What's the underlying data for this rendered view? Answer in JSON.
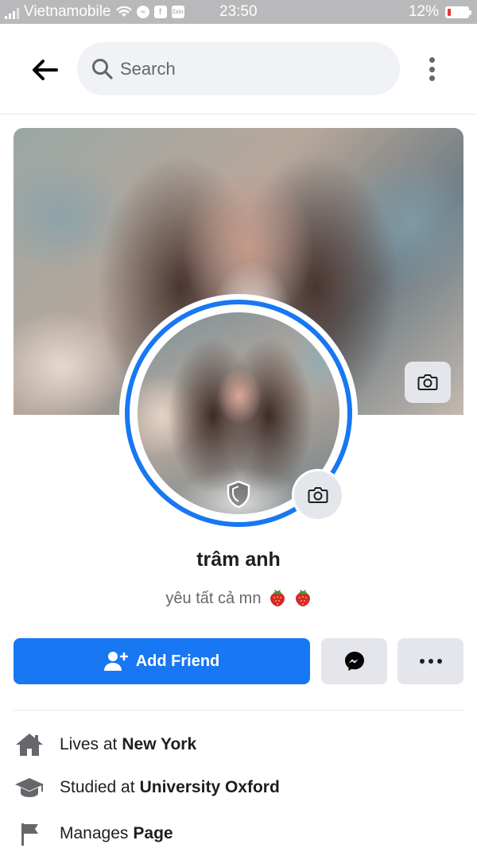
{
  "status_bar": {
    "carrier": "Vietnamobile",
    "time": "23:50",
    "battery": "12%",
    "battery_level": 0.12,
    "notification_icons": [
      "wifi-icon",
      "messenger-icon",
      "facebook-icon",
      "zalo-icon"
    ],
    "zalo_label": "Zalo"
  },
  "header": {
    "search_placeholder": "Search",
    "back_icon": "arrow-left-icon",
    "more_icon": "vertical-ellipsis-icon"
  },
  "profile": {
    "name": "trâm anh",
    "bio": "yêu tất cả mn",
    "bio_emojis": [
      "strawberry",
      "strawberry"
    ],
    "profile_guard": true
  },
  "actions": {
    "add_friend_label": "Add Friend",
    "message_icon": "messenger-icon",
    "more_icon": "horizontal-ellipsis-icon"
  },
  "details": [
    {
      "icon": "home-icon",
      "prefix": "Lives at",
      "value": "New York"
    },
    {
      "icon": "graduation-cap-icon",
      "prefix": "Studied at",
      "value": "University Oxford"
    },
    {
      "icon": "flag-icon",
      "prefix": "Manages",
      "value": "Page"
    }
  ],
  "colors": {
    "accent": "#1877f2",
    "status_bar": "#b9b9bb",
    "secondary_button": "#e4e6eb",
    "text_secondary": "#65676b"
  }
}
